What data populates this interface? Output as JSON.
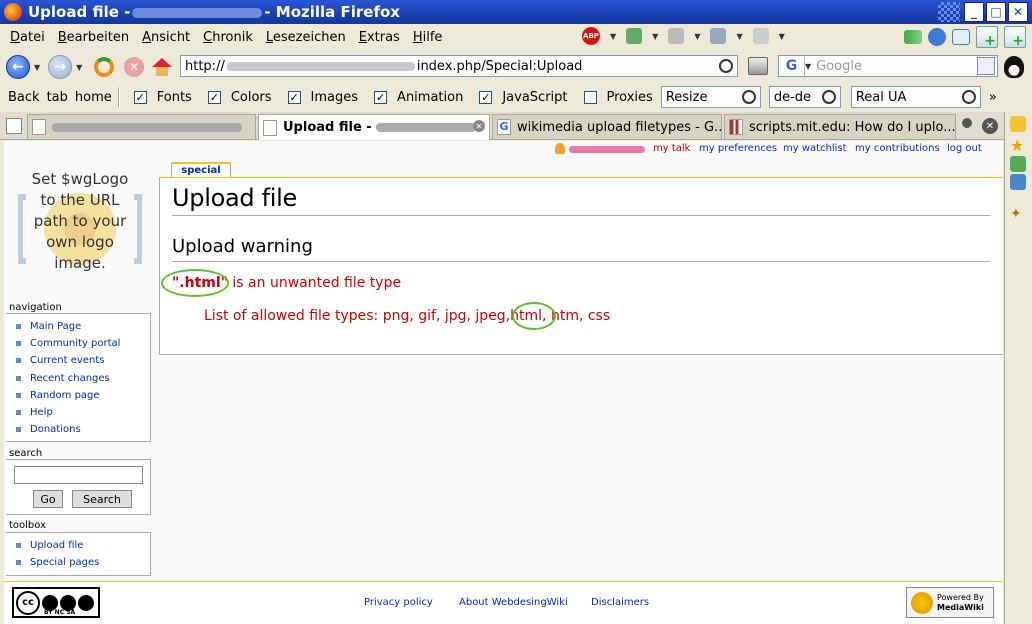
{
  "window": {
    "title_prefix": "Upload file -",
    "title_suffix": "- Mozilla Firefox"
  },
  "menu": [
    "Datei",
    "Bearbeiten",
    "Ansicht",
    "Chronik",
    "Lesezeichen",
    "Extras",
    "Hilfe"
  ],
  "menu_accel": [
    "D",
    "B",
    "A",
    "C",
    "L",
    "E",
    "H"
  ],
  "address": {
    "prefix": "http://",
    "suffix": "index.php/Special:Upload"
  },
  "search": {
    "placeholder": "Google",
    "engine_icon": "google-icon"
  },
  "devbar": {
    "links": [
      "Back",
      "tab",
      "home"
    ],
    "options": [
      {
        "label": "Fonts",
        "checked": true
      },
      {
        "label": "Colors",
        "checked": true
      },
      {
        "label": "Images",
        "checked": true
      },
      {
        "label": "Animation",
        "checked": true
      },
      {
        "label": "JavaScript",
        "checked": true
      },
      {
        "label": "Proxies",
        "checked": false
      }
    ],
    "resize": "Resize",
    "lang": "de-de",
    "ua": "Real UA",
    "more": "»"
  },
  "tabs": [
    {
      "label": "Upload file -",
      "active": true
    },
    {
      "label": "wikimedia upload filetypes - G...",
      "active": false
    },
    {
      "label": "scripts.mit.edu: How do I uplo...",
      "active": false
    }
  ],
  "userlinks": [
    "my talk",
    "my preferences",
    "my watchlist",
    "my contributions",
    "log out"
  ],
  "logo_text": [
    "Set $wgLogo",
    "to the URL",
    "path to your",
    "own logo",
    "image."
  ],
  "navigation": {
    "title": "navigation",
    "items": [
      "Main Page",
      "Community portal",
      "Current events",
      "Recent changes",
      "Random page",
      "Help",
      "Donations"
    ]
  },
  "search_box": {
    "title": "search",
    "go": "Go",
    "search": "Search"
  },
  "toolbox": {
    "title": "toolbox",
    "items": [
      "Upload file",
      "Special pages"
    ]
  },
  "content": {
    "tab": "special",
    "title": "Upload file",
    "warning_heading": "Upload warning",
    "file_type": "\".html\"",
    "warning_rest": "is an unwanted file type",
    "allowed_label": "List of allowed file types:",
    "allowed_types": "png, gif, jpg, jpeg,",
    "allowed_highlight": "html,",
    "allowed_tail": "htm, css"
  },
  "footer": {
    "links": [
      "Privacy policy",
      "About WebdesingWiki",
      "Disclaimers"
    ],
    "cc_text": "BY NC SA",
    "mw_badge": [
      "Powered By",
      "MediaWiki"
    ]
  },
  "colors": {
    "warning": "#cc0000",
    "highlight": "#5bc02a",
    "link": "#002bb8"
  }
}
